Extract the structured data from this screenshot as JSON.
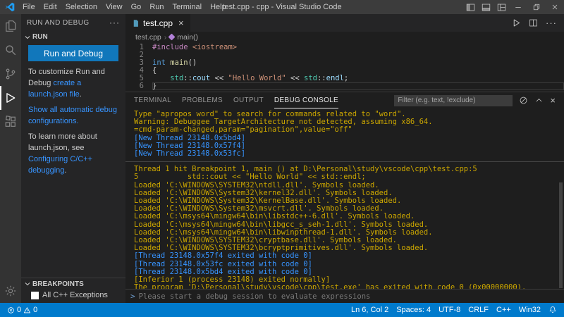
{
  "title_bar": {
    "title": "test.cpp - cpp - Visual Studio Code",
    "menus": [
      "File",
      "Edit",
      "Selection",
      "View",
      "Go",
      "Run",
      "Terminal",
      "Help"
    ]
  },
  "icons": {
    "more_actions": "···",
    "tab_close": "×",
    "panel_close": "×",
    "breadcrumb_sep": "›",
    "prompt": ">"
  },
  "sidebar": {
    "header": "RUN AND DEBUG",
    "run_section_label": "RUN",
    "run_button_label": "Run and Debug",
    "customize_prefix": "To customize Run and Debug ",
    "customize_link": "create a launch.json file",
    "customize_suffix": ".",
    "show_configs_link": "Show all automatic debug configurations.",
    "learn_prefix": "To learn more about launch.json, see ",
    "learn_link": "Configuring C/C++ debugging",
    "learn_suffix": ".",
    "breakpoints_header": "BREAKPOINTS",
    "breakpoint_label": "All C++ Exceptions"
  },
  "editor": {
    "tab_label": "test.cpp",
    "breadcrumb_file": "test.cpp",
    "breadcrumb_symbol": "main()",
    "code_lines": [
      {
        "num": "1",
        "tokens": [
          {
            "t": "#include",
            "c": "tok-pink"
          },
          {
            "t": " ",
            "c": "tok-plain"
          },
          {
            "t": "<iostream>",
            "c": "tok-string"
          }
        ]
      },
      {
        "num": "2",
        "tokens": []
      },
      {
        "num": "3",
        "tokens": [
          {
            "t": "int",
            "c": "tok-blue"
          },
          {
            "t": " ",
            "c": "tok-plain"
          },
          {
            "t": "main",
            "c": "tok-func"
          },
          {
            "t": "()",
            "c": "tok-plain"
          }
        ]
      },
      {
        "num": "4",
        "tokens": [
          {
            "t": "{",
            "c": "tok-plain"
          }
        ]
      },
      {
        "num": "5",
        "tokens": [
          {
            "t": "    ",
            "c": "tok-plain"
          },
          {
            "t": "std",
            "c": "tok-teal"
          },
          {
            "t": "::",
            "c": "tok-plain"
          },
          {
            "t": "cout",
            "c": "tok-var"
          },
          {
            "t": " << ",
            "c": "tok-plain"
          },
          {
            "t": "\"Hello World\"",
            "c": "tok-string"
          },
          {
            "t": " << ",
            "c": "tok-plain"
          },
          {
            "t": "std",
            "c": "tok-teal"
          },
          {
            "t": "::",
            "c": "tok-plain"
          },
          {
            "t": "endl",
            "c": "tok-var"
          },
          {
            "t": ";",
            "c": "tok-plain"
          }
        ]
      },
      {
        "num": "6",
        "tokens": [
          {
            "t": "}",
            "c": "tok-plain"
          }
        ],
        "current": true
      }
    ]
  },
  "panel": {
    "tabs": [
      {
        "label": "TERMINAL",
        "state": "inactive"
      },
      {
        "label": "PROBLEMS",
        "state": "inactive"
      },
      {
        "label": "OUTPUT",
        "state": "inactive"
      },
      {
        "label": "DEBUG CONSOLE",
        "state": "active"
      }
    ],
    "filter_placeholder": "Filter (e.g. text, !exclude)",
    "input_placeholder": "Please start a debug session to evaluate expressions",
    "console_lines": [
      {
        "text": "Type \"apropos word\" to search for commands related to \"word\".",
        "color": "warn"
      },
      {
        "text": "Warning: Debuggee TargetArchitecture not detected, assuming x86_64.",
        "color": "warn"
      },
      {
        "text": "=cmd-param-changed,param=\"pagination\",value=\"off\"",
        "color": "warn"
      },
      {
        "text": "[New Thread 23148.0x5bd4]",
        "color": "info"
      },
      {
        "text": "[New Thread 23148.0x57f4]",
        "color": "info"
      },
      {
        "text": "[New Thread 23148.0x53fc]",
        "color": "info"
      },
      {
        "text": "",
        "color": "separator"
      },
      {
        "text": "Thread 1 hit Breakpoint 1, main () at D:\\Personal\\study\\vscode\\cpp\\test.cpp:5",
        "color": "warn"
      },
      {
        "text": "5           std::cout << \"Hello World\" << std::endl;",
        "color": "warn"
      },
      {
        "text": "Loaded 'C:\\WINDOWS\\SYSTEM32\\ntdll.dll'. Symbols loaded.",
        "color": "warn"
      },
      {
        "text": "Loaded 'C:\\WINDOWS\\System32\\kernel32.dll'. Symbols loaded.",
        "color": "warn"
      },
      {
        "text": "Loaded 'C:\\WINDOWS\\System32\\KernelBase.dll'. Symbols loaded.",
        "color": "warn"
      },
      {
        "text": "Loaded 'C:\\WINDOWS\\System32\\msvcrt.dll'. Symbols loaded.",
        "color": "warn"
      },
      {
        "text": "Loaded 'C:\\msys64\\mingw64\\bin\\libstdc++-6.dll'. Symbols loaded.",
        "color": "warn"
      },
      {
        "text": "Loaded 'C:\\msys64\\mingw64\\bin\\libgcc_s_seh-1.dll'. Symbols loaded.",
        "color": "warn"
      },
      {
        "text": "Loaded 'C:\\msys64\\mingw64\\bin\\libwinpthread-1.dll'. Symbols loaded.",
        "color": "warn"
      },
      {
        "text": "Loaded 'C:\\WINDOWS\\SYSTEM32\\cryptbase.dll'. Symbols loaded.",
        "color": "warn"
      },
      {
        "text": "Loaded 'C:\\WINDOWS\\SYSTEM32\\bcryptprimitives.dll'. Symbols loaded.",
        "color": "warn"
      },
      {
        "text": "[Thread 23148.0x57f4 exited with code 0]",
        "color": "info"
      },
      {
        "text": "[Thread 23148.0x53fc exited with code 0]",
        "color": "info"
      },
      {
        "text": "[Thread 23148.0x5bd4 exited with code 0]",
        "color": "info"
      },
      {
        "text": "[Inferior 1 (process 23148) exited normally]",
        "color": "warn"
      },
      {
        "text": "The program 'D:\\Personal\\study\\vscode\\cpp\\test.exe' has exited with code 0 (0x00000000).",
        "color": "warn"
      }
    ]
  },
  "status_bar": {
    "error_count": "0",
    "warning_count": "0",
    "right_items": [
      "Ln 6, Col 2",
      "Spaces: 4",
      "UTF-8",
      "CRLF",
      "C++",
      "Win32"
    ]
  },
  "colors": {
    "status_bar": "#007acc",
    "run_button": "#1177bb",
    "link": "#3794ff",
    "console_info": "#3794ff",
    "console_warning": "#cca700"
  }
}
